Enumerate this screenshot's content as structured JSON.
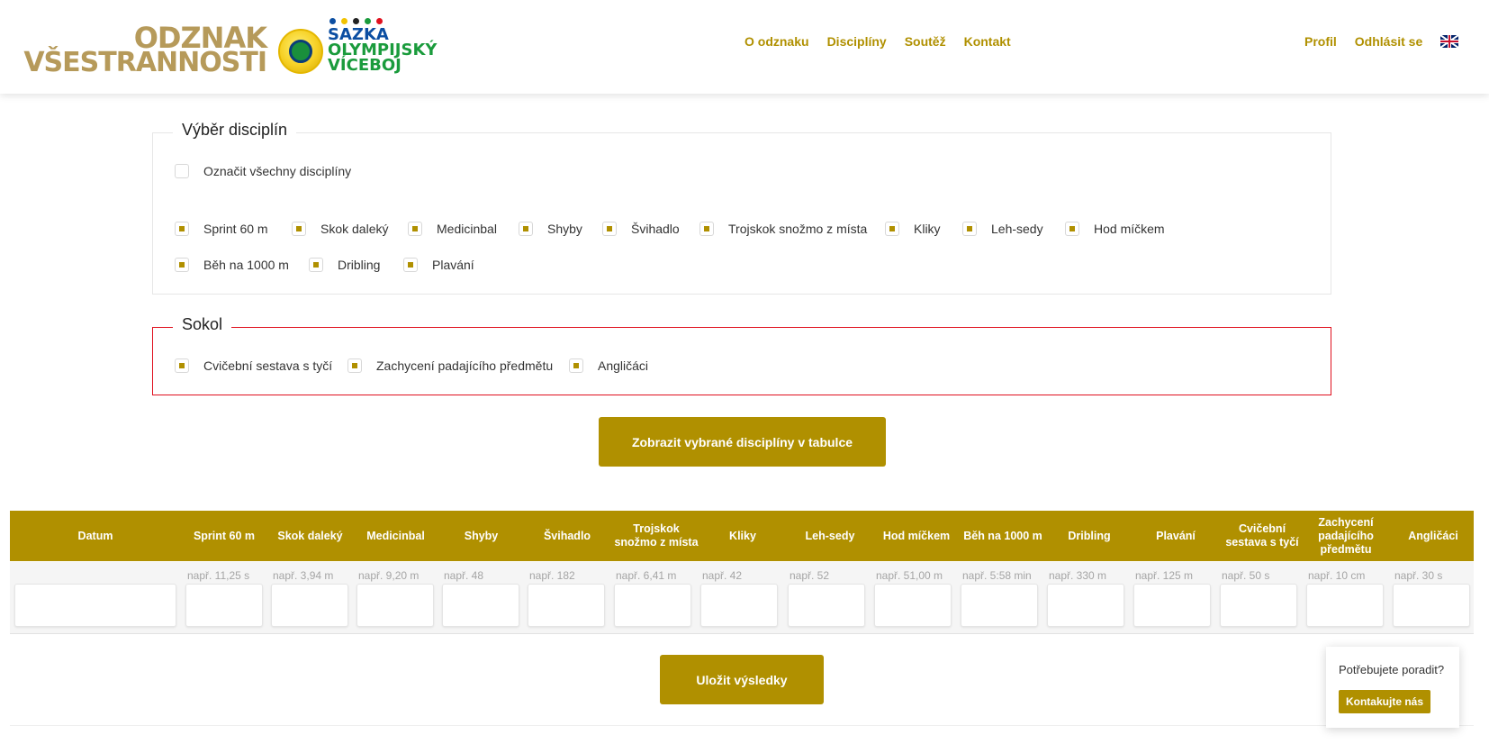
{
  "logo": {
    "line1": "ODZNAK",
    "line2": "VŠESTRANNOSTI",
    "brand1": "SAZKA",
    "brand2": "OLYMPIJSKÝ",
    "brand3": "VÍCEBOJ",
    "dot_colors": [
      "#0b4ea2",
      "#f2c200",
      "#222222",
      "#1a9b3c",
      "#e0101e"
    ]
  },
  "nav": {
    "items": [
      "O odznaku",
      "Disciplíny",
      "Soutěž",
      "Kontakt"
    ],
    "right": [
      "Profil",
      "Odhlásit se"
    ],
    "language_icon": "uk-flag-icon"
  },
  "disciplines": {
    "legend": "Výběr disciplín",
    "select_all": "Označit všechny disciplíny",
    "items": [
      "Sprint 60 m",
      "Skok daleký",
      "Medicinbal",
      "Shyby",
      "Švihadlo",
      "Trojskok snožmo z místa",
      "Kliky",
      "Leh-sedy",
      "Hod míčkem",
      "Běh na 1000 m",
      "Dribling",
      "Plavání"
    ]
  },
  "sokol": {
    "legend": "Sokol",
    "items": [
      "Cvičební sestava s tyčí",
      "Zachycení padajícího předmětu",
      "Angličáci"
    ]
  },
  "show_button": "Zobrazit vybrané disciplíny v tabulce",
  "table": {
    "headers": [
      "Datum",
      "Sprint 60 m",
      "Skok daleký",
      "Medicinbal",
      "Shyby",
      "Švihadlo",
      "Trojskok snožmo z místa",
      "Kliky",
      "Leh-sedy",
      "Hod míčkem",
      "Běh na 1000 m",
      "Dribling",
      "Plavání",
      "Cvičební sestava s tyčí",
      "Zachycení padajícího předmětu",
      "Angličáci"
    ],
    "hints": [
      "",
      "např. 11,25 s",
      "např. 3,94 m",
      "např. 9,20 m",
      "např. 48",
      "např. 182",
      "např. 6,41 m",
      "např. 42",
      "např. 52",
      "např. 51,00 m",
      "např. 5:58 min",
      "např. 330 m",
      "např. 125 m",
      "např. 50 s",
      "např. 10 cm",
      "např. 30 s"
    ]
  },
  "save_button": "Uložit výsledky",
  "help": {
    "question": "Potřebujete poradit?",
    "button": "Kontakujte nás"
  },
  "colors": {
    "accent": "#b09000",
    "sokol_border": "#e0101e"
  }
}
